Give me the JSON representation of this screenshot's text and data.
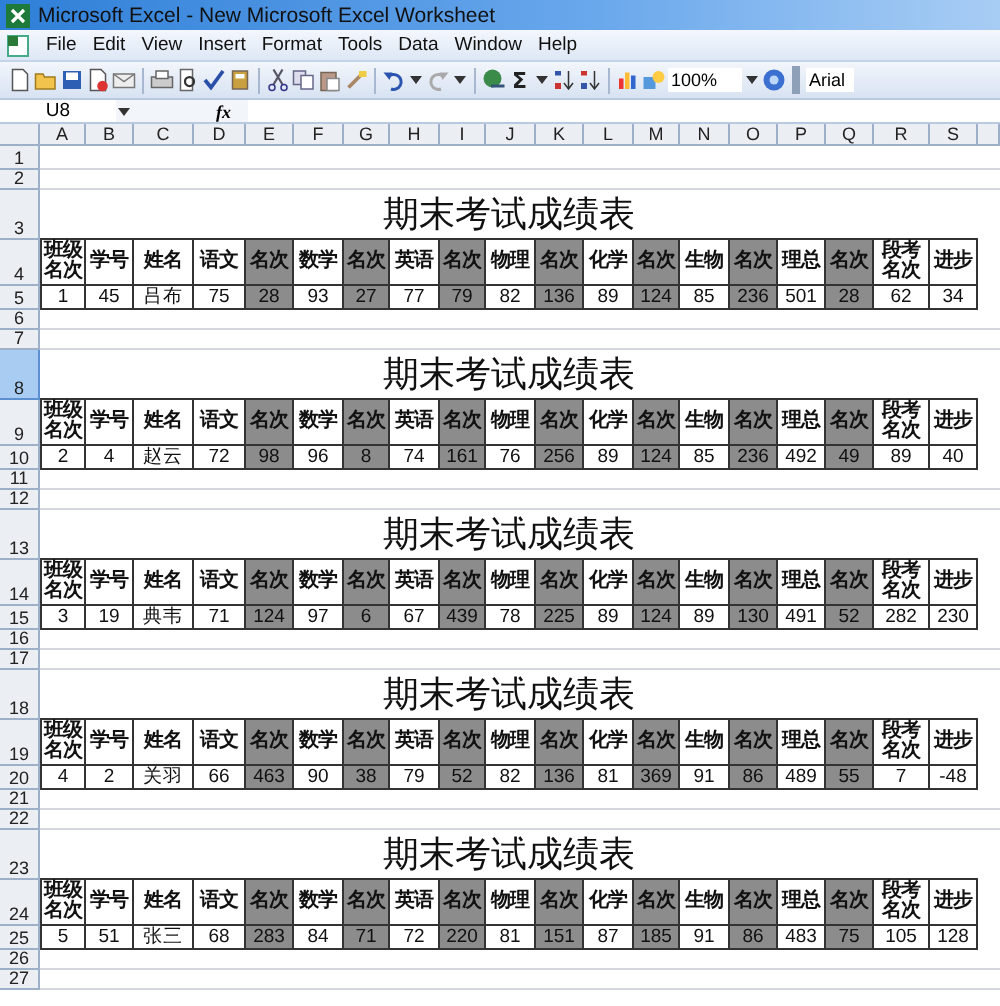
{
  "title_bar": {
    "title": "Microsoft Excel - New Microsoft Excel Worksheet"
  },
  "menu": [
    "File",
    "Edit",
    "View",
    "Insert",
    "Format",
    "Tools",
    "Data",
    "Window",
    "Help"
  ],
  "toolbar": {
    "autosum": "Σ",
    "zoom": "100%",
    "font": "Arial"
  },
  "formula_bar": {
    "name_box": "U8",
    "fx": "fx"
  },
  "columns": [
    "A",
    "B",
    "C",
    "D",
    "E",
    "F",
    "G",
    "H",
    "I",
    "J",
    "K",
    "L",
    "M",
    "N",
    "O",
    "P",
    "Q",
    "R",
    "S"
  ],
  "top_rows": [
    {
      "number": "1",
      "selected": false
    },
    {
      "number": "2",
      "selected": false
    }
  ],
  "blocks": [
    {
      "rows": [
        {
          "number": "3",
          "selected": false
        },
        {
          "number": "4",
          "selected": false
        },
        {
          "number": "5",
          "selected": false
        },
        {
          "number": "6",
          "selected": false
        },
        {
          "number": "7",
          "selected": false
        }
      ],
      "title": "期末考试成绩表",
      "headers": [
        {
          "text": "班级名次",
          "shaded": false
        },
        {
          "text": "学号",
          "shaded": false
        },
        {
          "text": "姓名",
          "shaded": false
        },
        {
          "text": "语文",
          "shaded": false
        },
        {
          "text": "名次",
          "shaded": true
        },
        {
          "text": "数学",
          "shaded": false
        },
        {
          "text": "名次",
          "shaded": true
        },
        {
          "text": "英语",
          "shaded": false
        },
        {
          "text": "名次",
          "shaded": true
        },
        {
          "text": "物理",
          "shaded": false
        },
        {
          "text": "名次",
          "shaded": true
        },
        {
          "text": "化学",
          "shaded": false
        },
        {
          "text": "名次",
          "shaded": true
        },
        {
          "text": "生物",
          "shaded": false
        },
        {
          "text": "名次",
          "shaded": true
        },
        {
          "text": "理总",
          "shaded": false
        },
        {
          "text": "名次",
          "shaded": true
        },
        {
          "text": "段考名次",
          "shaded": false
        },
        {
          "text": "进步",
          "shaded": false
        }
      ],
      "values": [
        "1",
        "45",
        "吕布",
        "75",
        "28",
        "93",
        "27",
        "77",
        "79",
        "82",
        "136",
        "89",
        "124",
        "85",
        "236",
        "501",
        "28",
        "62",
        "34"
      ]
    },
    {
      "rows": [
        {
          "number": "8",
          "selected": true
        },
        {
          "number": "9",
          "selected": false
        },
        {
          "number": "10",
          "selected": false
        },
        {
          "number": "11",
          "selected": false
        },
        {
          "number": "12",
          "selected": false
        }
      ],
      "title": "期末考试成绩表",
      "headers": [
        {
          "text": "班级名次",
          "shaded": false
        },
        {
          "text": "学号",
          "shaded": false
        },
        {
          "text": "姓名",
          "shaded": false
        },
        {
          "text": "语文",
          "shaded": false
        },
        {
          "text": "名次",
          "shaded": true
        },
        {
          "text": "数学",
          "shaded": false
        },
        {
          "text": "名次",
          "shaded": true
        },
        {
          "text": "英语",
          "shaded": false
        },
        {
          "text": "名次",
          "shaded": true
        },
        {
          "text": "物理",
          "shaded": false
        },
        {
          "text": "名次",
          "shaded": true
        },
        {
          "text": "化学",
          "shaded": false
        },
        {
          "text": "名次",
          "shaded": true
        },
        {
          "text": "生物",
          "shaded": false
        },
        {
          "text": "名次",
          "shaded": true
        },
        {
          "text": "理总",
          "shaded": false
        },
        {
          "text": "名次",
          "shaded": true
        },
        {
          "text": "段考名次",
          "shaded": false
        },
        {
          "text": "进步",
          "shaded": false
        }
      ],
      "values": [
        "2",
        "4",
        "赵云",
        "72",
        "98",
        "96",
        "8",
        "74",
        "161",
        "76",
        "256",
        "89",
        "124",
        "85",
        "236",
        "492",
        "49",
        "89",
        "40"
      ]
    },
    {
      "rows": [
        {
          "number": "13",
          "selected": false
        },
        {
          "number": "14",
          "selected": false
        },
        {
          "number": "15",
          "selected": false
        },
        {
          "number": "16",
          "selected": false
        },
        {
          "number": "17",
          "selected": false
        }
      ],
      "title": "期末考试成绩表",
      "headers": [
        {
          "text": "班级名次",
          "shaded": false
        },
        {
          "text": "学号",
          "shaded": false
        },
        {
          "text": "姓名",
          "shaded": false
        },
        {
          "text": "语文",
          "shaded": false
        },
        {
          "text": "名次",
          "shaded": true
        },
        {
          "text": "数学",
          "shaded": false
        },
        {
          "text": "名次",
          "shaded": true
        },
        {
          "text": "英语",
          "shaded": false
        },
        {
          "text": "名次",
          "shaded": true
        },
        {
          "text": "物理",
          "shaded": false
        },
        {
          "text": "名次",
          "shaded": true
        },
        {
          "text": "化学",
          "shaded": false
        },
        {
          "text": "名次",
          "shaded": true
        },
        {
          "text": "生物",
          "shaded": false
        },
        {
          "text": "名次",
          "shaded": true
        },
        {
          "text": "理总",
          "shaded": false
        },
        {
          "text": "名次",
          "shaded": true
        },
        {
          "text": "段考名次",
          "shaded": false
        },
        {
          "text": "进步",
          "shaded": false
        }
      ],
      "values": [
        "3",
        "19",
        "典韦",
        "71",
        "124",
        "97",
        "6",
        "67",
        "439",
        "78",
        "225",
        "89",
        "124",
        "89",
        "130",
        "491",
        "52",
        "282",
        "230"
      ]
    },
    {
      "rows": [
        {
          "number": "18",
          "selected": false
        },
        {
          "number": "19",
          "selected": false
        },
        {
          "number": "20",
          "selected": false
        },
        {
          "number": "21",
          "selected": false
        },
        {
          "number": "22",
          "selected": false
        }
      ],
      "title": "期末考试成绩表",
      "headers": [
        {
          "text": "班级名次",
          "shaded": false
        },
        {
          "text": "学号",
          "shaded": false
        },
        {
          "text": "姓名",
          "shaded": false
        },
        {
          "text": "语文",
          "shaded": false
        },
        {
          "text": "名次",
          "shaded": true
        },
        {
          "text": "数学",
          "shaded": false
        },
        {
          "text": "名次",
          "shaded": true
        },
        {
          "text": "英语",
          "shaded": false
        },
        {
          "text": "名次",
          "shaded": true
        },
        {
          "text": "物理",
          "shaded": false
        },
        {
          "text": "名次",
          "shaded": true
        },
        {
          "text": "化学",
          "shaded": false
        },
        {
          "text": "名次",
          "shaded": true
        },
        {
          "text": "生物",
          "shaded": false
        },
        {
          "text": "名次",
          "shaded": true
        },
        {
          "text": "理总",
          "shaded": false
        },
        {
          "text": "名次",
          "shaded": true
        },
        {
          "text": "段考名次",
          "shaded": false
        },
        {
          "text": "进步",
          "shaded": false
        }
      ],
      "values": [
        "4",
        "2",
        "关羽",
        "66",
        "463",
        "90",
        "38",
        "79",
        "52",
        "82",
        "136",
        "81",
        "369",
        "91",
        "86",
        "489",
        "55",
        "7",
        "-48"
      ]
    },
    {
      "rows": [
        {
          "number": "23",
          "selected": false
        },
        {
          "number": "24",
          "selected": false
        },
        {
          "number": "25",
          "selected": false
        },
        {
          "number": "26",
          "selected": false
        },
        {
          "number": "27",
          "selected": false
        }
      ],
      "title": "期末考试成绩表",
      "headers": [
        {
          "text": "班级名次",
          "shaded": false
        },
        {
          "text": "学号",
          "shaded": false
        },
        {
          "text": "姓名",
          "shaded": false
        },
        {
          "text": "语文",
          "shaded": false
        },
        {
          "text": "名次",
          "shaded": true
        },
        {
          "text": "数学",
          "shaded": false
        },
        {
          "text": "名次",
          "shaded": true
        },
        {
          "text": "英语",
          "shaded": false
        },
        {
          "text": "名次",
          "shaded": true
        },
        {
          "text": "物理",
          "shaded": false
        },
        {
          "text": "名次",
          "shaded": true
        },
        {
          "text": "化学",
          "shaded": false
        },
        {
          "text": "名次",
          "shaded": true
        },
        {
          "text": "生物",
          "shaded": false
        },
        {
          "text": "名次",
          "shaded": true
        },
        {
          "text": "理总",
          "shaded": false
        },
        {
          "text": "名次",
          "shaded": true
        },
        {
          "text": "段考名次",
          "shaded": false
        },
        {
          "text": "进步",
          "shaded": false
        }
      ],
      "values": [
        "5",
        "51",
        "张三",
        "68",
        "283",
        "84",
        "71",
        "72",
        "220",
        "81",
        "151",
        "87",
        "185",
        "91",
        "86",
        "483",
        "75",
        "105",
        "128"
      ]
    }
  ]
}
